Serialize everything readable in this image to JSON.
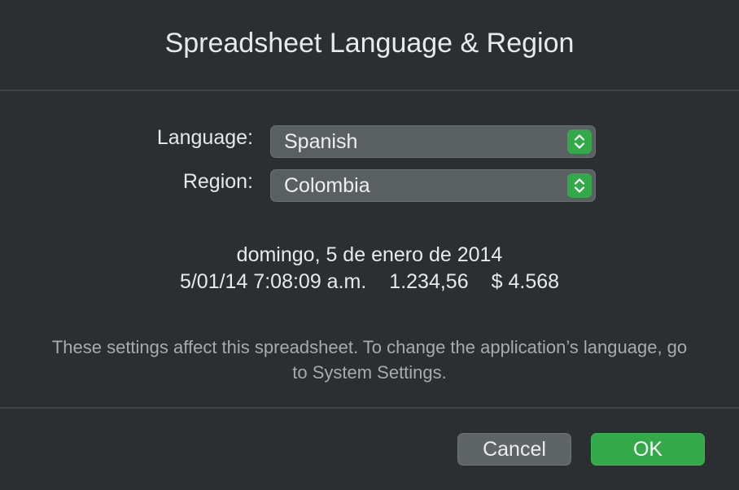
{
  "dialog": {
    "title": "Spreadsheet Language & Region"
  },
  "fields": {
    "language": {
      "label": "Language:",
      "value": "Spanish"
    },
    "region": {
      "label": "Region:",
      "value": "Colombia"
    }
  },
  "preview": {
    "long_date": "domingo, 5 de enero de 2014",
    "short_datetime": "5/01/14 7:08:09 a.m.",
    "number": "1.234,56",
    "currency": "$ 4.568"
  },
  "note": "These settings affect this spreadsheet. To change the application’s language, go to System Settings.",
  "buttons": {
    "cancel": "Cancel",
    "ok": "OK"
  },
  "colors": {
    "accent": "#33a94a",
    "background": "#2b2f31"
  },
  "icons": {
    "popup_stepper": "chevron-up-down-icon"
  }
}
